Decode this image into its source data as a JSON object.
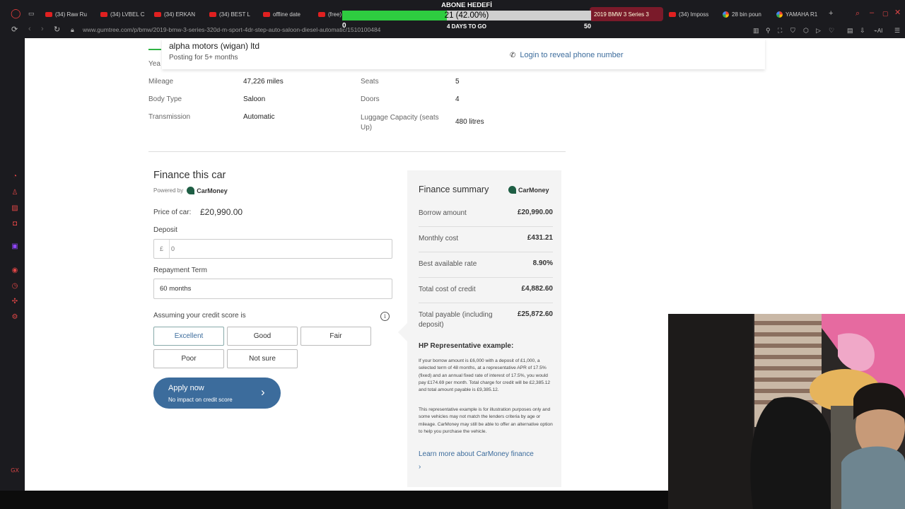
{
  "browser": {
    "tabs": [
      {
        "label": "(34) Raw Ru",
        "icon": "youtube-icon"
      },
      {
        "label": "(34) LVBEL C",
        "icon": "youtube-icon"
      },
      {
        "label": "(34) ERKAN",
        "icon": "youtube-icon"
      },
      {
        "label": "(34) BEST L",
        "icon": "youtube-icon"
      },
      {
        "label": "offline date",
        "icon": "youtube-icon"
      },
      {
        "label": "(free)",
        "icon": "youtube-icon"
      },
      {
        "label": "2019 BMW 3 Series 3",
        "icon": "gumtree-icon"
      },
      {
        "label": "(34) Imposs",
        "icon": "youtube-icon"
      },
      {
        "label": "28 bin poun",
        "icon": "google-icon"
      },
      {
        "label": "YAMAHA R1",
        "icon": "google-icon"
      }
    ],
    "url": "www.gumtree.com/p/bmw/2019-bmw-3-series-320d-m-sport-4dr-step-auto-saloon-diesel-automatic/1510100484"
  },
  "overlay": {
    "title": "ABONE HEDEFİ",
    "progress_text": "21 (42.00%)",
    "progress_fraction": 0.42,
    "min": "0",
    "max": "50",
    "subtitle": "4 DAYS TO GO"
  },
  "seller": {
    "name": "alpha motors (wigan) ltd",
    "meta": "Posting for 5+ months",
    "phone_link": "Login to reveal phone number"
  },
  "specs": {
    "partial_label": "Yea",
    "mileage_label": "Mileage",
    "mileage": "47,226 miles",
    "body_label": "Body Type",
    "body": "Saloon",
    "transmission_label": "Transmission",
    "transmission": "Automatic",
    "seats_label": "Seats",
    "seats": "5",
    "doors_label": "Doors",
    "doors": "4",
    "luggage_label": "Luggage Capacity (seats Up)",
    "luggage": "480 litres"
  },
  "finance": {
    "title": "Finance this car",
    "powered_by": "Powered by",
    "provider": "CarMoney",
    "price_label": "Price of car:",
    "price": "£20,990.00",
    "deposit_label": "Deposit",
    "deposit_currency": "£",
    "deposit_placeholder": "0",
    "term_label": "Repayment Term",
    "term_value": "60 months",
    "credit_label": "Assuming your credit score is",
    "credit_options": [
      "Excellent",
      "Good",
      "Fair",
      "Poor",
      "Not sure"
    ],
    "apply_label": "Apply now",
    "apply_sub": "No impact on credit score"
  },
  "summary": {
    "title": "Finance summary",
    "provider": "CarMoney",
    "rows": [
      {
        "label": "Borrow amount",
        "value": "£20,990.00"
      },
      {
        "label": "Monthly cost",
        "value": "£431.21"
      },
      {
        "label": "Best available rate",
        "value": "8.90%"
      },
      {
        "label": "Total cost of credit",
        "value": "£4,882.60"
      },
      {
        "label": "Total payable (including deposit)",
        "value": "£25,872.60"
      }
    ],
    "hp_title": "HP Representative example:",
    "hp_text": "If your borrow amount is £6,000 with a deposit of £1,000, a selected term of 48 months, at a representative APR of 17.5% (fixed) and an annual fixed rate of interest of 17.5%, you would pay £174.69 per month. Total charge for credit will be £2,385.12 and total amount payable is £9,385.12.",
    "disclaimer": "This representative example is for illustration purposes only and some vehicles may not match the lenders criteria by age or mileage. CarMoney may still be able to offer an alternative option to help you purchase the vehicle.",
    "learn_more": "Learn more about CarMoney finance"
  },
  "colors": {
    "link": "#3c6c9c",
    "goal_fill": "#2ecc40",
    "active_tab": "#7a1a2a",
    "sidebar_icons": "#e04646"
  }
}
